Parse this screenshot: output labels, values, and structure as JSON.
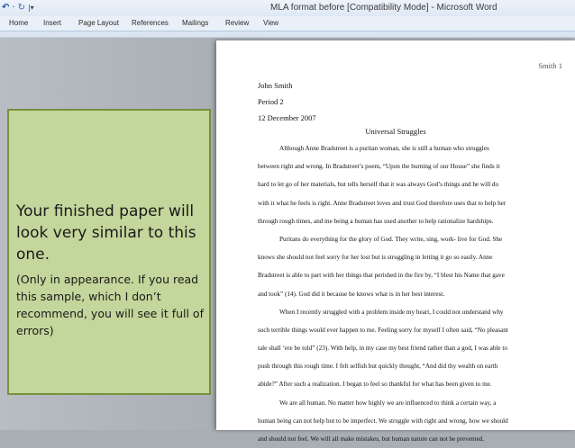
{
  "window": {
    "title": "MLA format before [Compatibility Mode]  -  Microsoft Word",
    "quick_access": [
      "word-icon",
      "undo-icon",
      "redo-icon",
      "customize-icon"
    ]
  },
  "ribbon": {
    "tabs": [
      "Home",
      "Insert",
      "Page Layout",
      "References",
      "Mailings",
      "Review",
      "View"
    ]
  },
  "document": {
    "header": "Smith 1",
    "author": "John Smith",
    "period": "Period 2",
    "date": "12 December 2007",
    "title": "Universal Struggles",
    "lines": [
      "Although Anne Bradstreet is a puritan woman, she is still a human who struggles",
      "between right and wrong. In Bradstreet’s poem, “Upon the burning of our House” she finds it",
      "hard to let go of her materials, but tells  herself that it was always God’s things and he will do",
      "with it what he feels is right. Anne Bradstreet loves and trust God therefore uses that to help her",
      "through rough times, and me being a human has used another to help rationalize hardships.",
      "Puritans do everything for the glory of God. They write, sing, work- live for God. She",
      "knows she should not feel sorry for her lost but is struggling in letting it go so easily. Anne",
      "Bradstreet is able to part with her things that perished in the fire by, “I blest his Name that gave",
      "and took” (14).  God did it because he knows what is in her best interest.",
      "When I recently struggled with a problem inside my heart, I could not understand why",
      "such terrible things would ever happen to me. Feeling sorry for myself I often said, “No pleasant",
      "tale shall ‘ere be told” (23). With help, in my case my best friend rather than a god, I was able to",
      "push through this rough time. I felt selfish but quickly thought, “And did thy wealth on earth",
      "abide?” After such a realization. I began to feel so thankful for what has been given to me.",
      "We are all human. No matter how highly we are influenced to think a certain way, a",
      "human being can not help but to be imperfect. We struggle with right and wrong, how we should",
      "and should not feel. We will all make mistakes, but human nature can not be prevented."
    ],
    "indented": [
      0,
      5,
      9,
      14
    ]
  },
  "note": {
    "headline": "Your finished paper will look very similar to this one.",
    "detail": "(Only in appearance. If you read this sample, which I don’t recommend, you will see it full of errors)"
  },
  "colors": {
    "note_fill": "#c3d69b",
    "note_border": "#76923c",
    "workspace": "#a9aeb5"
  }
}
